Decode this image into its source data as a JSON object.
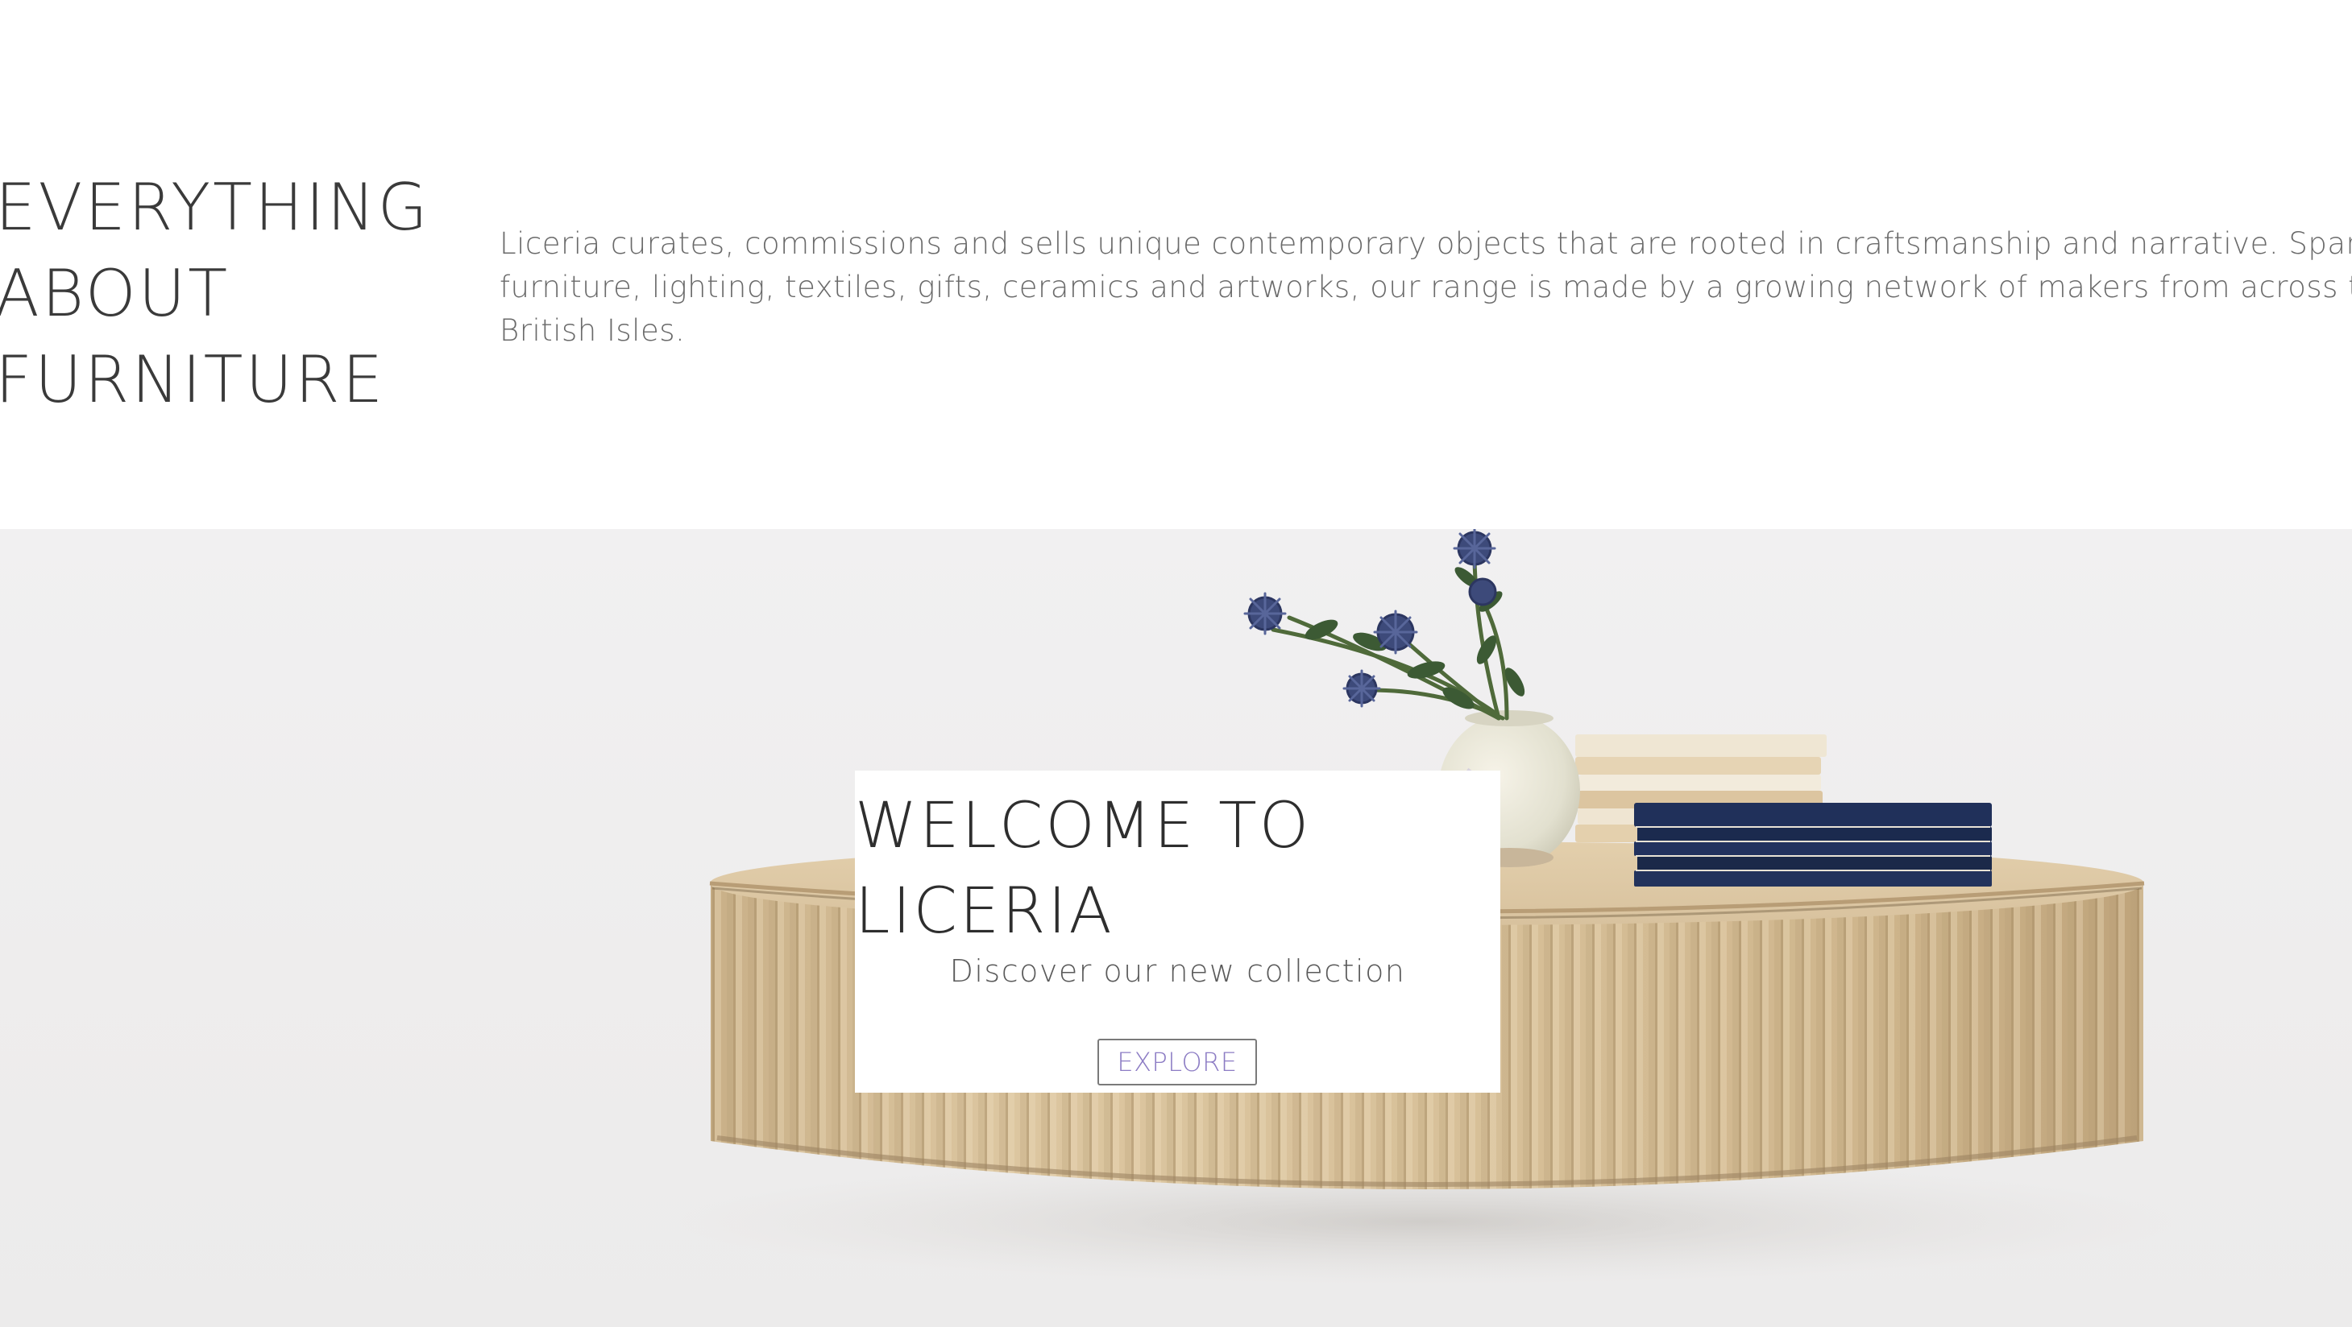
{
  "intro": {
    "heading_lines": [
      "EVERYTHING",
      "ABOUT",
      "FURNITURE"
    ],
    "description_lines": [
      "Liceria curates, commissions and sells unique contemporary objects that are rooted in craftsmanship and narrative. Spanning",
      "furniture, lighting, textiles, gifts, ceramics and artworks, our range is made by a growing network of makers from across the",
      "British Isles."
    ]
  },
  "hero": {
    "image_subject": "fluted oak round coffee table with vase, thistle stems and stacked books",
    "welcome": {
      "title_lines": [
        "WELCOME TO",
        "LICERIA"
      ],
      "subtitle": "Discover our new collection",
      "button_label": "EXPLORE"
    }
  },
  "colors": {
    "heading": "#3a3a3a",
    "body_text": "#6a6a6a",
    "hero_background": "#eeeded",
    "card_background": "#ffffff",
    "button_text": "#8c7cc4",
    "button_border": "#7a7a7a",
    "oak": "#d6bf98",
    "book_navy": "#1e2b4f"
  }
}
